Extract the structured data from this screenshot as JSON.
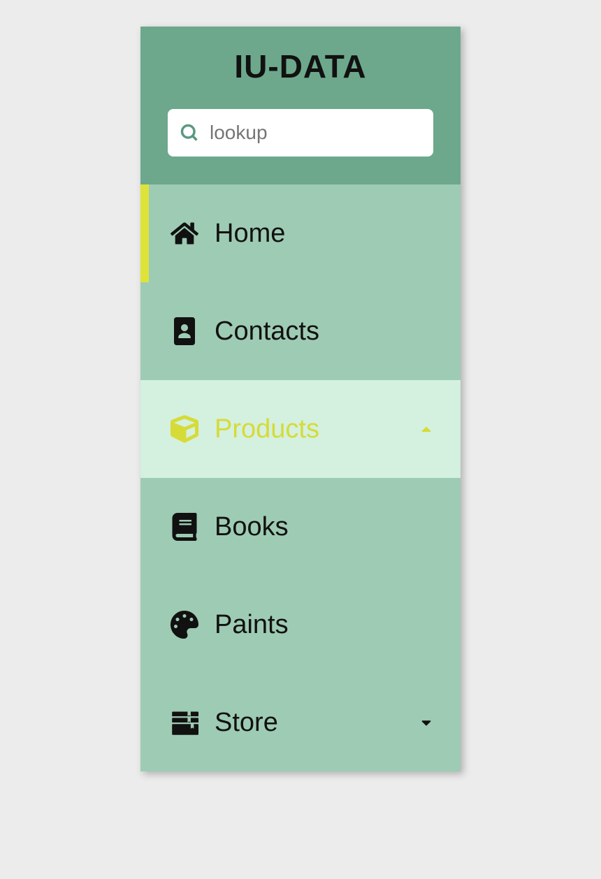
{
  "header": {
    "logo": "IU-DATA",
    "search_placeholder": "lookup"
  },
  "nav": {
    "items": [
      {
        "label": "Home"
      },
      {
        "label": "Contacts"
      },
      {
        "label": "Products"
      },
      {
        "label": "Books"
      },
      {
        "label": "Paints"
      },
      {
        "label": "Store"
      }
    ]
  },
  "colors": {
    "header_bg": "#6da88c",
    "sidebar_bg": "#9ecbb3",
    "expanded_bg": "#d4f0df",
    "accent": "#dee33a",
    "page_bg": "#ececec"
  }
}
